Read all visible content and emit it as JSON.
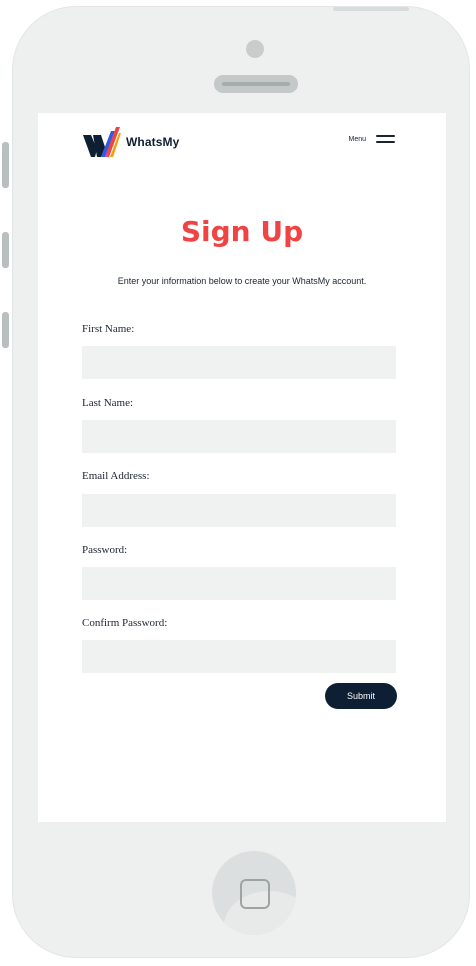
{
  "header": {
    "brand_name": "WhatsMy",
    "logo_icon": "whatsmy-logo-icon",
    "menu_label": "Menu",
    "menu_icon": "hamburger-icon"
  },
  "page": {
    "title": "Sign Up",
    "subtitle": "Enter your information below to create your WhatsMy account."
  },
  "form": {
    "fields": [
      {
        "label": "First Name:",
        "value": "",
        "placeholder": ""
      },
      {
        "label": "Last Name:",
        "value": "",
        "placeholder": ""
      },
      {
        "label": "Email Address:",
        "value": "",
        "placeholder": ""
      },
      {
        "label": "Password:",
        "value": "",
        "placeholder": ""
      },
      {
        "label": "Confirm Password:",
        "value": "",
        "placeholder": ""
      }
    ],
    "submit_label": "Submit"
  },
  "colors": {
    "accent_red": "#f04444",
    "navy": "#0f1f33",
    "input_bg": "#f0f2f2",
    "logo_blue": "#2f5be0",
    "logo_red": "#ef4444",
    "logo_orange": "#f59e0b",
    "logo_pink": "#ec4899"
  }
}
